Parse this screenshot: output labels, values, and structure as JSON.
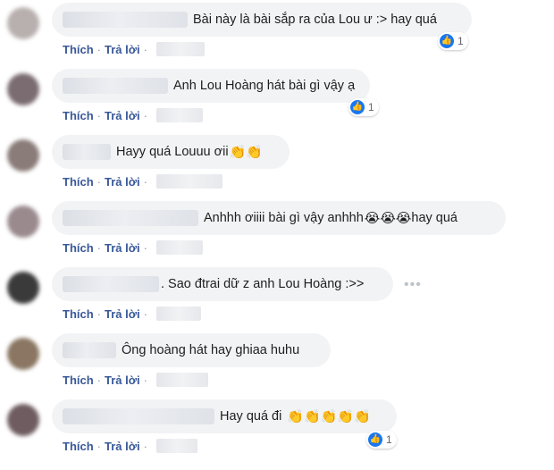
{
  "actions": {
    "like": "Thích",
    "reply": "Trả lời",
    "separator": "·"
  },
  "more_glyph": "•••",
  "like_glyph": "👍",
  "colors": {
    "bubble": "#f2f3f5",
    "link": "#385898",
    "like_blue": "#1877f2"
  },
  "comments": [
    {
      "author": "[blurred]",
      "text": "Bài này là bài sắp ra của Lou ư :> hay quá",
      "emoji": "",
      "reactions": "1",
      "avatar_color": "#b8b0ae"
    },
    {
      "author": "[blurred]",
      "text": "Anh Lou Hoàng hát bài gì vậy ạ",
      "emoji": "",
      "reactions": "1",
      "avatar_color": "#7a6c70"
    },
    {
      "author": "[blurred]",
      "text": "Hayy quá Louuu ơii",
      "emoji": "👏👏",
      "reactions": "",
      "avatar_color": "#8a7c78"
    },
    {
      "author": "[blurred]",
      "text": "Anhhh ơiiii bài gì vậy anhhh",
      "emoji": "😭😭😭",
      "text_after": " hay quá",
      "reactions": "",
      "avatar_color": "#9a8a8e"
    },
    {
      "author": "[blurred]",
      "text": ". Sao đtrai dữ z anh Lou Hoàng :>>",
      "emoji": "",
      "reactions": "",
      "avatar_color": "#3a3a3a"
    },
    {
      "author": "[blurred]",
      "text": "Ông hoàng hát hay ghiaa huhu",
      "emoji": "",
      "reactions": "",
      "avatar_color": "#8a7662"
    },
    {
      "author": "[blurred]",
      "text": "Hay quá đi",
      "emoji": "👏👏👏👏👏",
      "reactions": "1",
      "avatar_color": "#6e5c60"
    }
  ]
}
